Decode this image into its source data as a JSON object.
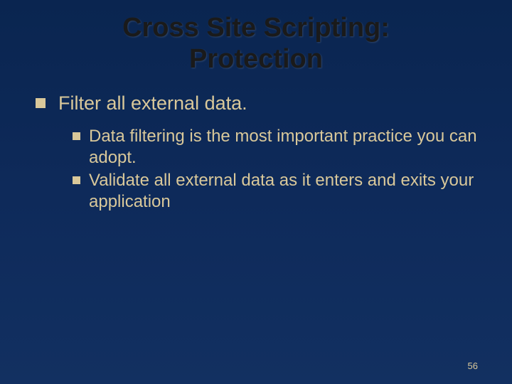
{
  "title_line1": "Cross Site Scripting:",
  "title_line2": "Protection",
  "bullets": {
    "level1": {
      "text": "Filter all external data."
    },
    "level2": [
      {
        "text": "Data filtering is the most important practice you can adopt."
      },
      {
        "text": "Validate all external data as it enters and exits your application"
      }
    ]
  },
  "page_number": "56"
}
